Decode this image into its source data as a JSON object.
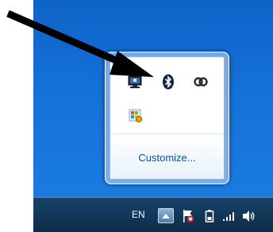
{
  "notification_area": {
    "overflow_icons": [
      {
        "name": "network-icon"
      },
      {
        "name": "bluetooth-icon"
      },
      {
        "name": "link-icon"
      },
      {
        "name": "windows-update-icon"
      }
    ],
    "customize_label": "Customize..."
  },
  "taskbar": {
    "language": "EN",
    "tray_icons": [
      {
        "name": "show-hidden-icons-button"
      },
      {
        "name": "action-center-icon"
      },
      {
        "name": "battery-icon"
      },
      {
        "name": "signal-icon"
      },
      {
        "name": "volume-icon"
      }
    ]
  }
}
